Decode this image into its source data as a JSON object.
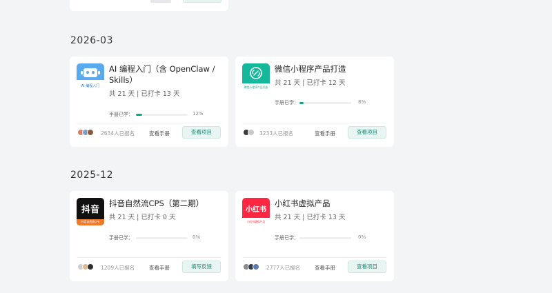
{
  "sections": [
    {
      "label": "2026-03",
      "cards": [
        {
          "title": "AI 编程入门（含 OpenClaw / Skills）",
          "meta": "共 21 天 | 已打卡 13 天",
          "thumb_text": "AI 编程入门",
          "progress_label": "手册已学：",
          "progress": 12,
          "progress_text": "12%",
          "enrolled": "2634人已报名",
          "manual": "查看手册",
          "action": "查看项目"
        },
        {
          "title": "微信小程序产品打造",
          "meta": "共 21 天 | 已打卡 12 天",
          "thumb_text": "微信小程序产品打造",
          "progress_label": "手册已学：",
          "progress": 8,
          "progress_text": "8%",
          "enrolled": "3233人已报名",
          "manual": "查看手册",
          "action": "查看项目"
        }
      ]
    },
    {
      "label": "2025-12",
      "cards": [
        {
          "title": "抖音自然流CPS（第二期）",
          "meta": "共 21 天 | 已打卡 0 天",
          "thumb_text": "抖音",
          "thumb_sub": "抖音自然流CPS",
          "progress_label": "手册已学：",
          "progress": 0,
          "progress_text": "0%",
          "enrolled": "1209人已报名",
          "manual": "查看手册",
          "action": "填写反馈"
        },
        {
          "title": "小红书虚拟产品",
          "meta": "共 21 天 | 已打卡 13 天",
          "thumb_text": "小红书",
          "thumb_sub": "小红书虚拟产品",
          "progress_label": "手册已学：",
          "progress": 0,
          "progress_text": "0%",
          "enrolled": "2777人已报名",
          "manual": "查看手册",
          "action": "查看项目"
        }
      ]
    }
  ],
  "colors": {
    "accent": "#12a58a",
    "background": "#f3f4f6"
  }
}
